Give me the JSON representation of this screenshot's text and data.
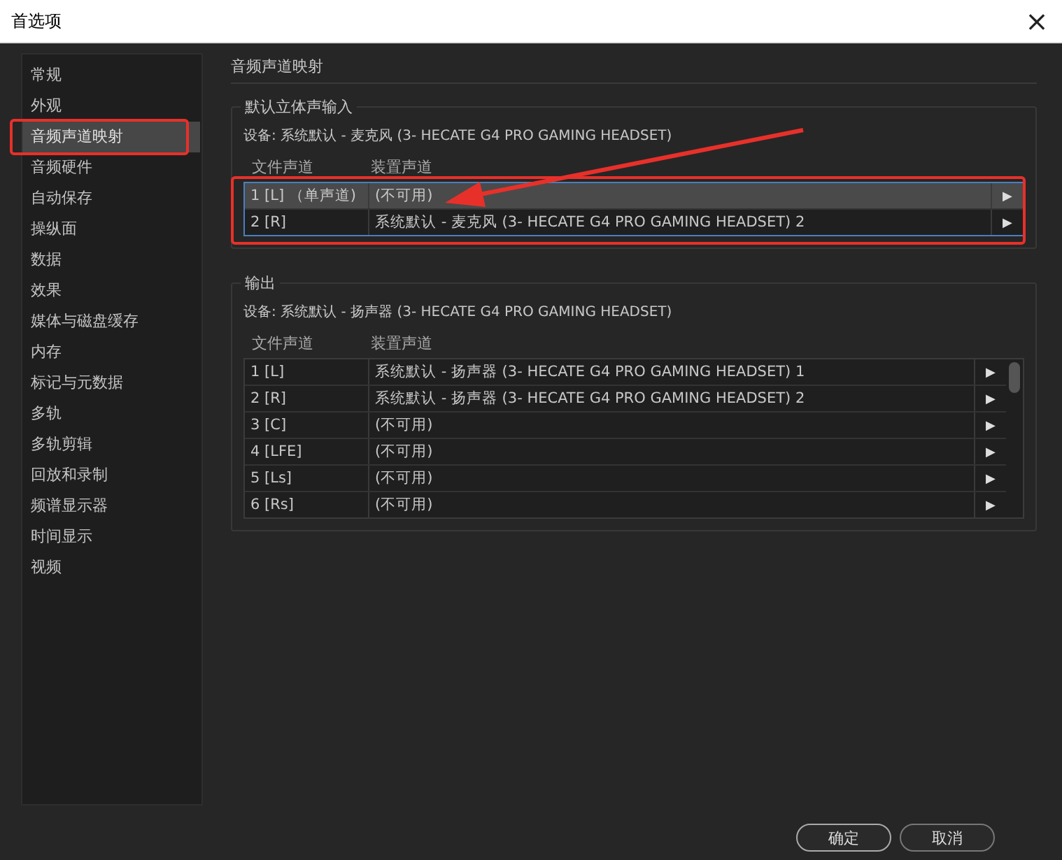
{
  "window": {
    "title": "首选项",
    "close": "×"
  },
  "sidebar": {
    "items": [
      {
        "label": "常规",
        "selected": false,
        "highlighted": false
      },
      {
        "label": "外观",
        "selected": false,
        "highlighted": false
      },
      {
        "label": "音频声道映射",
        "selected": true,
        "highlighted": true
      },
      {
        "label": "音频硬件",
        "selected": false,
        "highlighted": false
      },
      {
        "label": "自动保存",
        "selected": false,
        "highlighted": false
      },
      {
        "label": "操纵面",
        "selected": false,
        "highlighted": false
      },
      {
        "label": "数据",
        "selected": false,
        "highlighted": false
      },
      {
        "label": "效果",
        "selected": false,
        "highlighted": false
      },
      {
        "label": "媒体与磁盘缓存",
        "selected": false,
        "highlighted": false
      },
      {
        "label": "内存",
        "selected": false,
        "highlighted": false
      },
      {
        "label": "标记与元数据",
        "selected": false,
        "highlighted": false
      },
      {
        "label": "多轨",
        "selected": false,
        "highlighted": false
      },
      {
        "label": "多轨剪辑",
        "selected": false,
        "highlighted": false
      },
      {
        "label": "回放和录制",
        "selected": false,
        "highlighted": false
      },
      {
        "label": "频谱显示器",
        "selected": false,
        "highlighted": false
      },
      {
        "label": "时间显示",
        "selected": false,
        "highlighted": false
      },
      {
        "label": "视频",
        "selected": false,
        "highlighted": false
      }
    ]
  },
  "page_title": "音频声道映射",
  "groups": [
    {
      "title": "默认立体声输入",
      "device": "设备: 系统默认 - 麦克风 (3- HECATE G4 PRO GAMING HEADSET)",
      "highlighted": true,
      "arrow": true,
      "scrollbar": false,
      "columns": [
        "文件声道",
        "装置声道"
      ],
      "rows": [
        {
          "file_channel": "1 [L] （单声道)",
          "device_channel": "(不可用)",
          "selected": true,
          "expand": "▶"
        },
        {
          "file_channel": "2 [R]",
          "device_channel": "系统默认 - 麦克风 (3- HECATE G4 PRO GAMING HEADSET) 2",
          "selected": false,
          "expand": "▶"
        }
      ]
    },
    {
      "title": "输出",
      "device": "设备: 系统默认 - 扬声器 (3- HECATE G4 PRO GAMING HEADSET)",
      "highlighted": false,
      "arrow": false,
      "scrollbar": true,
      "columns": [
        "文件声道",
        "装置声道"
      ],
      "rows": [
        {
          "file_channel": "1 [L]",
          "device_channel": "系统默认 - 扬声器 (3- HECATE G4 PRO GAMING HEADSET) 1",
          "selected": false,
          "expand": "▶"
        },
        {
          "file_channel": "2 [R]",
          "device_channel": "系统默认 - 扬声器 (3- HECATE G4 PRO GAMING HEADSET) 2",
          "selected": false,
          "expand": "▶"
        },
        {
          "file_channel": "3 [C]",
          "device_channel": "(不可用)",
          "selected": false,
          "expand": "▶"
        },
        {
          "file_channel": "4 [LFE]",
          "device_channel": "(不可用)",
          "selected": false,
          "expand": "▶"
        },
        {
          "file_channel": "5 [Ls]",
          "device_channel": "(不可用)",
          "selected": false,
          "expand": "▶"
        },
        {
          "file_channel": "6 [Rs]",
          "device_channel": "(不可用)",
          "selected": false,
          "expand": "▶"
        }
      ]
    }
  ],
  "buttons": [
    "确定",
    "取消"
  ]
}
